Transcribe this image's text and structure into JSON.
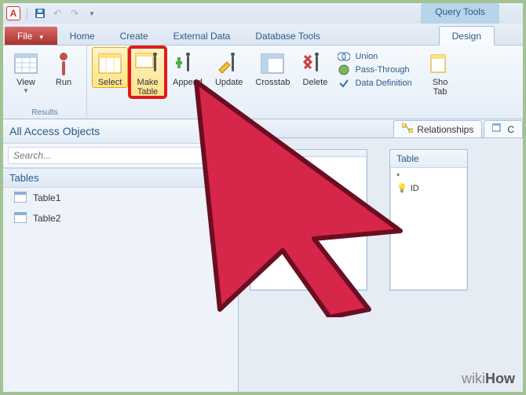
{
  "titlebar": {
    "app_letter": "A"
  },
  "context_tool_header": "Query Tools",
  "tabs": {
    "file": "File",
    "home": "Home",
    "create": "Create",
    "external": "External Data",
    "dbtools": "Database Tools",
    "design": "Design"
  },
  "ribbon": {
    "results": {
      "label": "Results",
      "view": "View",
      "run": "Run"
    },
    "querytype": {
      "select": "Select",
      "maketable": "Make\nTable",
      "append": "Append",
      "update": "Update",
      "crosstab": "Crosstab",
      "delete": "Delete",
      "union": "Union",
      "passthrough": "Pass-Through",
      "datadef": "Data Definition"
    },
    "showhide": {
      "show": "Sho",
      "tab": "Tab"
    }
  },
  "nav": {
    "header": "All Access Objects",
    "search_placeholder": "Search...",
    "section": "Tables",
    "items": [
      "Table1",
      "Table2"
    ]
  },
  "doc": {
    "tab_relationships": "Relationships",
    "tab_other": "C",
    "card1_title": "",
    "card2_title": "Table",
    "card2_row0": "*",
    "card2_row1": "ID"
  },
  "watermark": {
    "a": "wiki",
    "b": "How"
  }
}
